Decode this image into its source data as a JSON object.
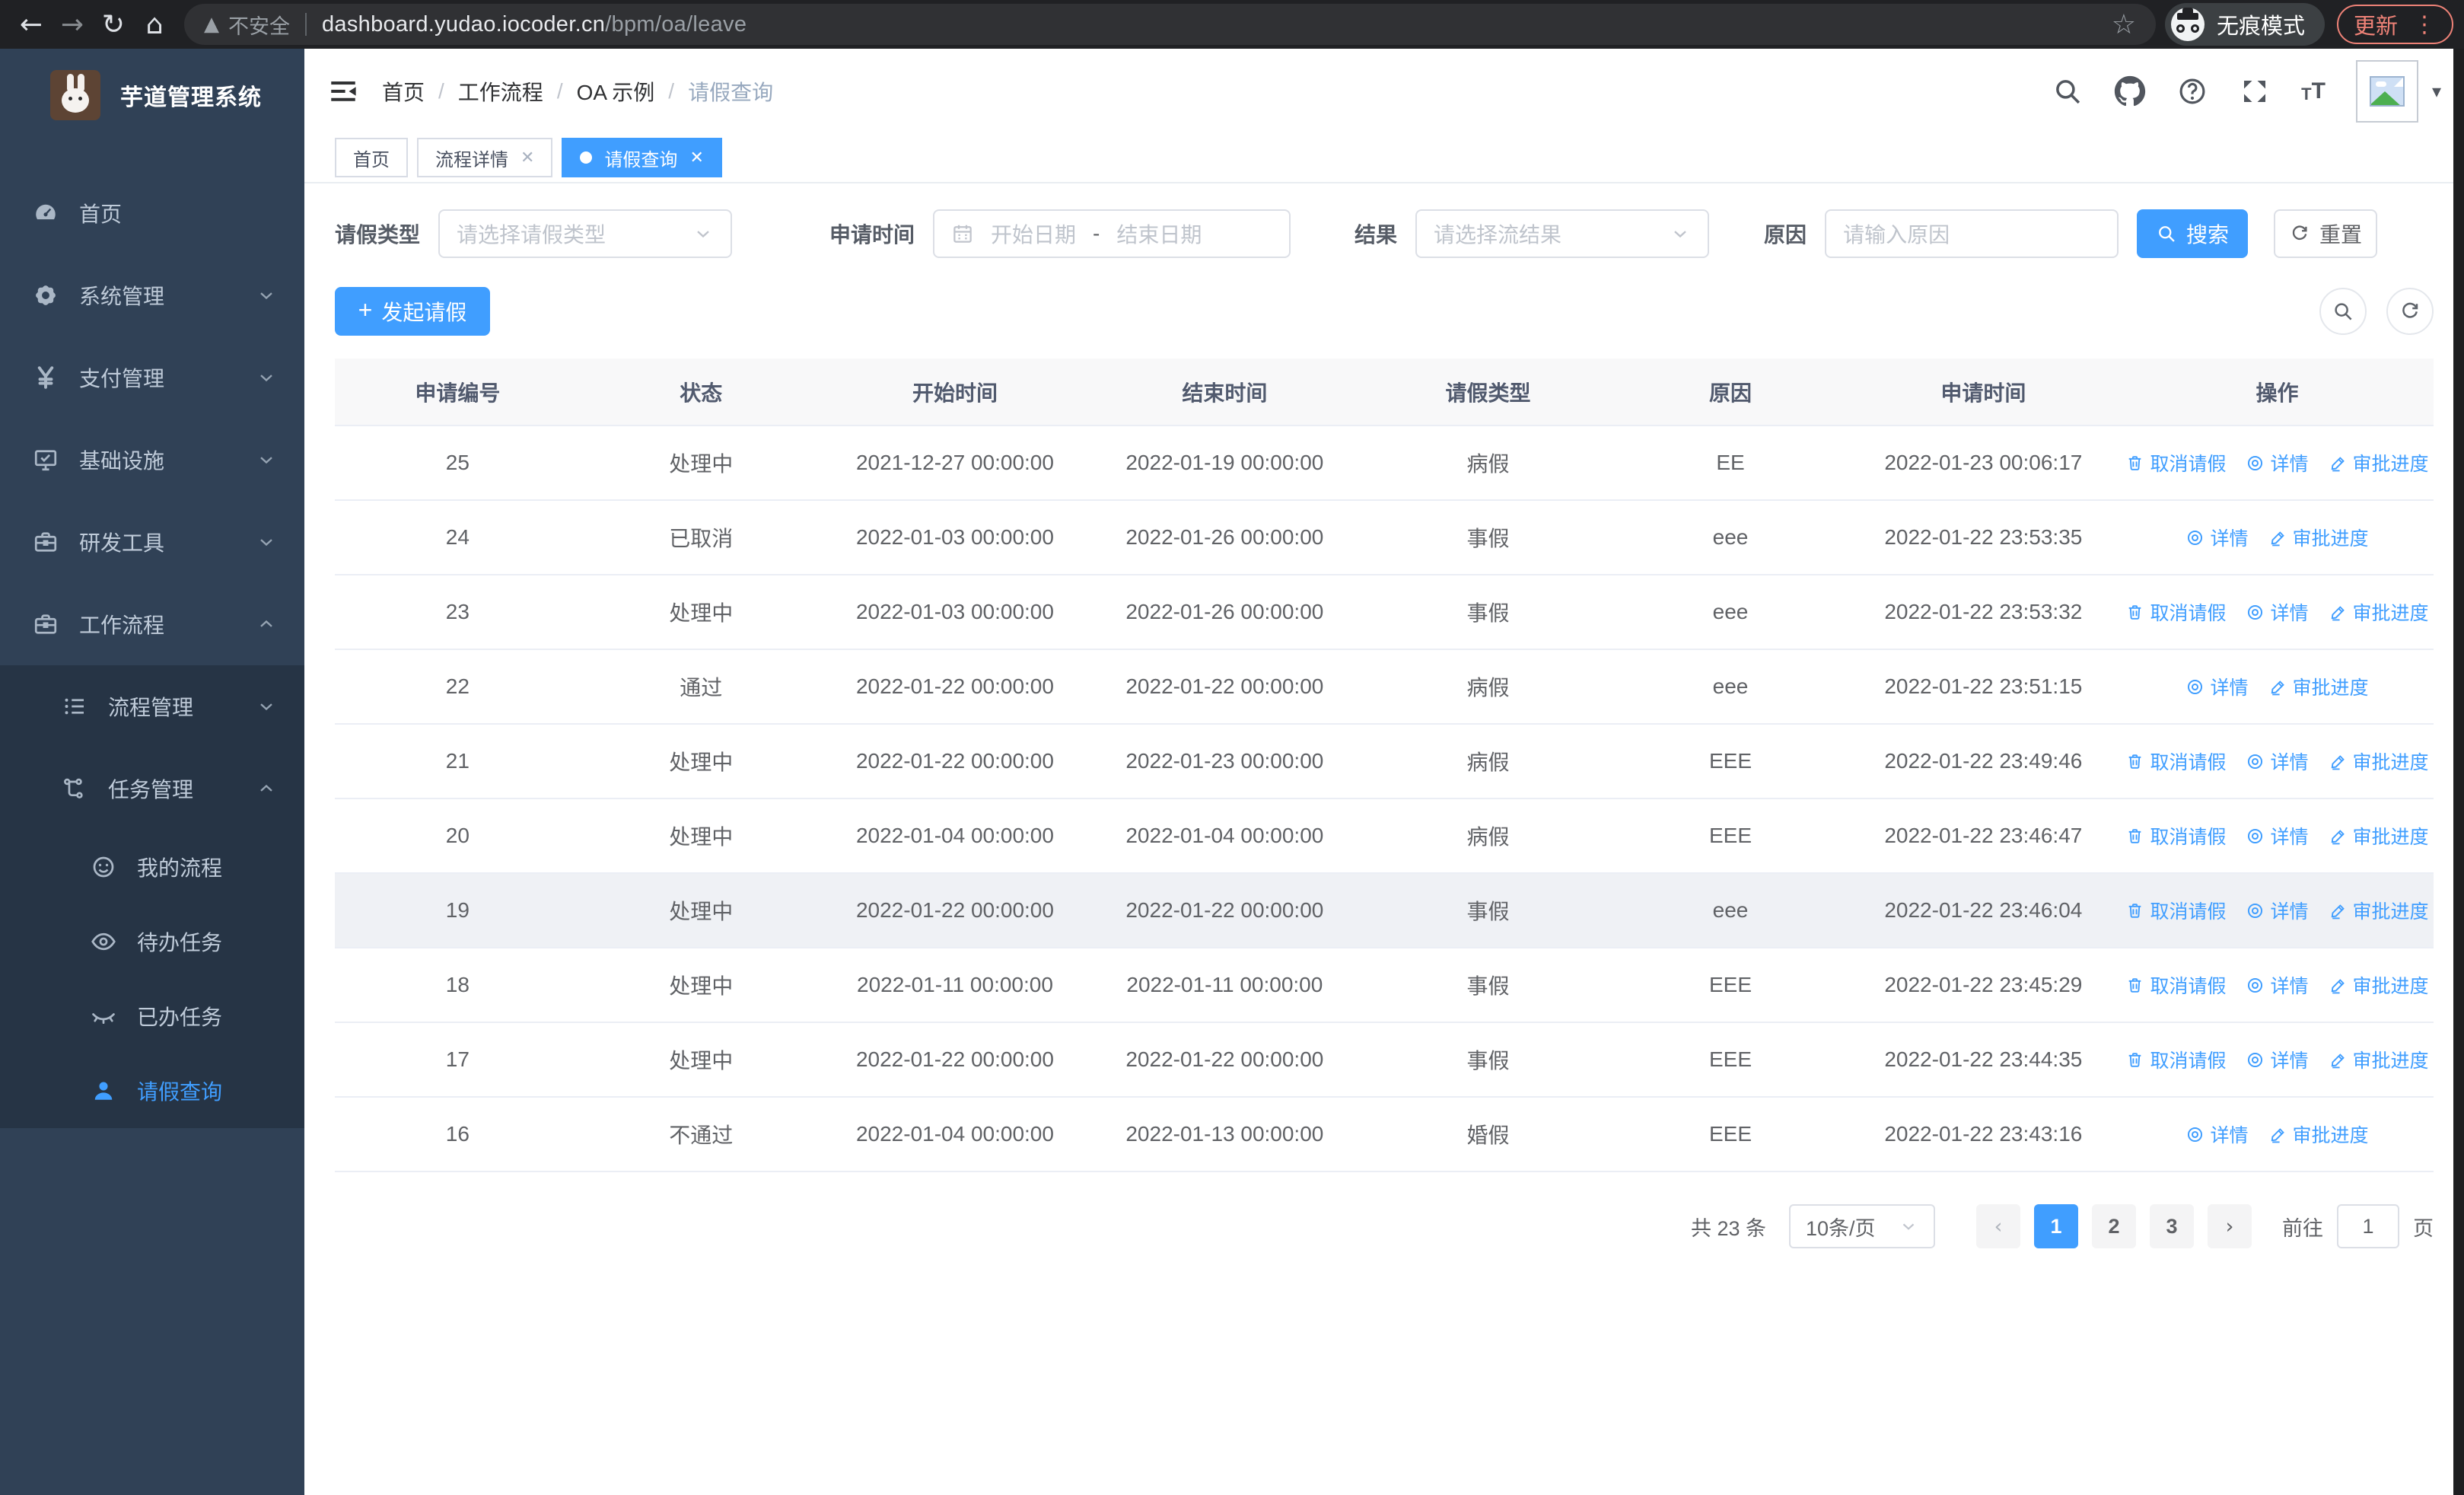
{
  "colors": {
    "accent": "#409eff",
    "sidebar_bg": "#304156",
    "sidebar_submenu_bg": "#263445",
    "update_chip": "#ee8277",
    "browser_bar": "#202124"
  },
  "browser": {
    "security_label": "不安全",
    "url_host": "dashboard.yudao.iocoder.cn",
    "url_path": "/bpm/oa/leave",
    "incognito_label": "无痕模式",
    "update_label": "更新"
  },
  "sidebar": {
    "app_title": "芋道管理系统",
    "items": [
      {
        "label": "首页",
        "icon": "gauge",
        "level": 1
      },
      {
        "label": "系统管理",
        "icon": "gear",
        "level": 1,
        "chevron": "down"
      },
      {
        "label": "支付管理",
        "icon": "yen",
        "level": 1,
        "chevron": "down"
      },
      {
        "label": "基础设施",
        "icon": "monitor",
        "level": 1,
        "chevron": "down"
      },
      {
        "label": "研发工具",
        "icon": "suitcase",
        "level": 1,
        "chevron": "down"
      },
      {
        "label": "工作流程",
        "icon": "suitcase",
        "level": 1,
        "chevron": "up",
        "children": [
          {
            "label": "流程管理",
            "icon": "list",
            "level": 2,
            "chevron": "down"
          },
          {
            "label": "任务管理",
            "icon": "share",
            "level": 2,
            "chevron": "up",
            "children": [
              {
                "label": "我的流程",
                "icon": "face",
                "level": 3
              },
              {
                "label": "待办任务",
                "icon": "eye",
                "level": 3
              },
              {
                "label": "已办任务",
                "icon": "eyeclosed",
                "level": 3
              },
              {
                "label": "请假查询",
                "icon": "user",
                "level": 3,
                "active": true
              }
            ]
          }
        ]
      }
    ]
  },
  "header": {
    "breadcrumb": [
      "首页",
      "工作流程",
      "OA 示例",
      "请假查询"
    ]
  },
  "tabs": [
    {
      "label": "首页",
      "closable": false,
      "active": false
    },
    {
      "label": "流程详情",
      "closable": true,
      "active": false
    },
    {
      "label": "请假查询",
      "closable": true,
      "active": true
    }
  ],
  "filters": {
    "leave_type_label": "请假类型",
    "leave_type_placeholder": "请选择请假类型",
    "apply_time_label": "申请时间",
    "start_date_placeholder": "开始日期",
    "range_separator": "-",
    "end_date_placeholder": "结束日期",
    "result_label": "结果",
    "result_placeholder": "请选择流结果",
    "reason_label": "原因",
    "reason_placeholder": "请输入原因",
    "search_label": "搜索",
    "reset_label": "重置"
  },
  "toolbar": {
    "create_label": "发起请假"
  },
  "table": {
    "columns": [
      "申请编号",
      "状态",
      "开始时间",
      "结束时间",
      "请假类型",
      "原因",
      "申请时间",
      "操作"
    ],
    "action_labels": {
      "cancel": "取消请假",
      "detail": "详情",
      "progress": "审批进度"
    },
    "rows": [
      {
        "id": "25",
        "status": "处理中",
        "start": "2021-12-27 00:00:00",
        "end": "2022-01-19 00:00:00",
        "type": "病假",
        "reason": "EE",
        "apply_time": "2022-01-23 00:06:17",
        "actions": [
          "cancel",
          "detail",
          "progress"
        ],
        "highlighted": false
      },
      {
        "id": "24",
        "status": "已取消",
        "start": "2022-01-03 00:00:00",
        "end": "2022-01-26 00:00:00",
        "type": "事假",
        "reason": "eee",
        "apply_time": "2022-01-22 23:53:35",
        "actions": [
          "detail",
          "progress"
        ],
        "highlighted": false
      },
      {
        "id": "23",
        "status": "处理中",
        "start": "2022-01-03 00:00:00",
        "end": "2022-01-26 00:00:00",
        "type": "事假",
        "reason": "eee",
        "apply_time": "2022-01-22 23:53:32",
        "actions": [
          "cancel",
          "detail",
          "progress"
        ],
        "highlighted": false
      },
      {
        "id": "22",
        "status": "通过",
        "start": "2022-01-22 00:00:00",
        "end": "2022-01-22 00:00:00",
        "type": "病假",
        "reason": "eee",
        "apply_time": "2022-01-22 23:51:15",
        "actions": [
          "detail",
          "progress"
        ],
        "highlighted": false
      },
      {
        "id": "21",
        "status": "处理中",
        "start": "2022-01-22 00:00:00",
        "end": "2022-01-23 00:00:00",
        "type": "病假",
        "reason": "EEE",
        "apply_time": "2022-01-22 23:49:46",
        "actions": [
          "cancel",
          "detail",
          "progress"
        ],
        "highlighted": false
      },
      {
        "id": "20",
        "status": "处理中",
        "start": "2022-01-04 00:00:00",
        "end": "2022-01-04 00:00:00",
        "type": "病假",
        "reason": "EEE",
        "apply_time": "2022-01-22 23:46:47",
        "actions": [
          "cancel",
          "detail",
          "progress"
        ],
        "highlighted": false
      },
      {
        "id": "19",
        "status": "处理中",
        "start": "2022-01-22 00:00:00",
        "end": "2022-01-22 00:00:00",
        "type": "事假",
        "reason": "eee",
        "apply_time": "2022-01-22 23:46:04",
        "actions": [
          "cancel",
          "detail",
          "progress"
        ],
        "highlighted": true
      },
      {
        "id": "18",
        "status": "处理中",
        "start": "2022-01-11 00:00:00",
        "end": "2022-01-11 00:00:00",
        "type": "事假",
        "reason": "EEE",
        "apply_time": "2022-01-22 23:45:29",
        "actions": [
          "cancel",
          "detail",
          "progress"
        ],
        "highlighted": false
      },
      {
        "id": "17",
        "status": "处理中",
        "start": "2022-01-22 00:00:00",
        "end": "2022-01-22 00:00:00",
        "type": "事假",
        "reason": "EEE",
        "apply_time": "2022-01-22 23:44:35",
        "actions": [
          "cancel",
          "detail",
          "progress"
        ],
        "highlighted": false
      },
      {
        "id": "16",
        "status": "不通过",
        "start": "2022-01-04 00:00:00",
        "end": "2022-01-13 00:00:00",
        "type": "婚假",
        "reason": "EEE",
        "apply_time": "2022-01-22 23:43:16",
        "actions": [
          "detail",
          "progress"
        ],
        "highlighted": false
      }
    ]
  },
  "pagination": {
    "total_label": "共 23 条",
    "page_size_label": "10条/页",
    "pages": [
      "1",
      "2",
      "3"
    ],
    "active_page": "1",
    "goto_label": "前往",
    "goto_value": "1",
    "page_unit_label": "页"
  }
}
